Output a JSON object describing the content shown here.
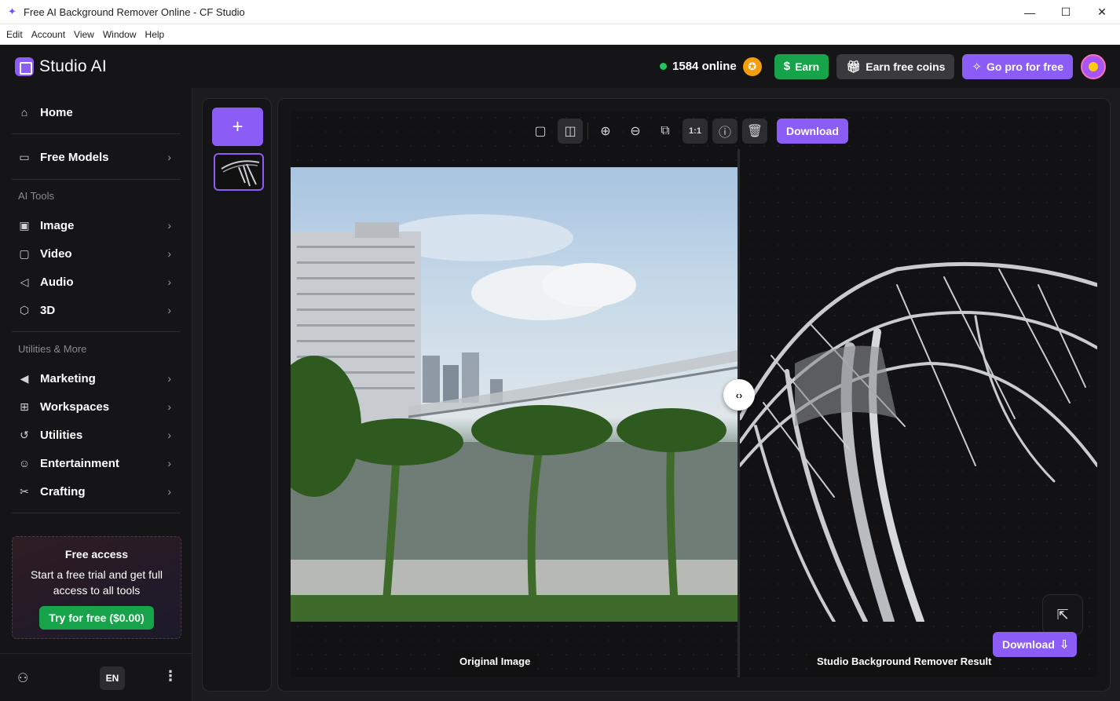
{
  "window": {
    "title": "Free AI Background Remover Online - CF Studio",
    "minimize_glyph": "—",
    "maximize_glyph": "☐",
    "close_glyph": "✕"
  },
  "menu": [
    "Edit",
    "Account",
    "View",
    "Window",
    "Help"
  ],
  "header": {
    "logo_text": "Studio AI",
    "online_text": "1584 online",
    "earn_label": "Earn",
    "earn_coins_label": "Earn free coins",
    "go_pro_label": "Go pro for free"
  },
  "sidebar": {
    "home": "Home",
    "free_models": "Free Models",
    "ai_tools_heading": "AI Tools",
    "ai_tools": [
      "Image",
      "Video",
      "Audio",
      "3D"
    ],
    "utilities_heading": "Utilities & More",
    "utilities": [
      "Marketing",
      "Workspaces",
      "Utilities",
      "Entertainment",
      "Crafting"
    ],
    "promo": {
      "title": "Free access",
      "text": "Start a free trial and get full access to all tools",
      "button": "Try for free ($0.00)"
    },
    "language": "EN"
  },
  "editor": {
    "toolbar_download": "Download",
    "original_caption": "Original Image",
    "result_caption": "Studio Background Remover Result",
    "download_label": "Download",
    "split_handle_glyph": "‹›"
  },
  "colors": {
    "accent": "#8b5cf6",
    "success": "#16a34a",
    "online_dot": "#22c55e",
    "coin": "#f59e0b"
  },
  "icons": {
    "app": "sparkle-icon",
    "home": "home-icon",
    "models": "monitor-icon",
    "image": "image-icon",
    "video": "tv-icon",
    "audio": "speaker-icon",
    "3d": "cube-icon",
    "marketing": "megaphone-icon",
    "workspaces": "grid-icon",
    "utilities": "history-icon",
    "entertainment": "game-icon",
    "crafting": "scissors-icon"
  }
}
